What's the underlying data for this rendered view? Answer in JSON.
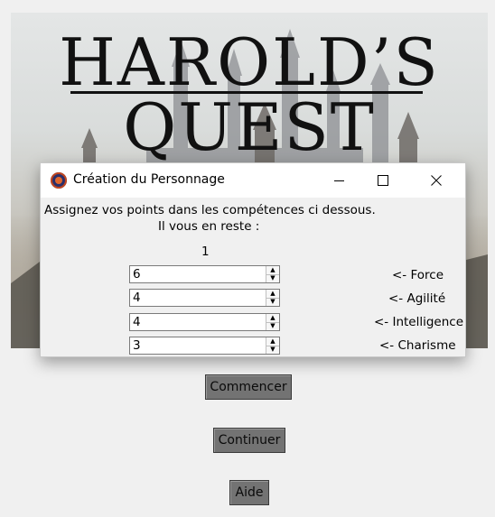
{
  "banner": {
    "title_line1": "HAROLD’S",
    "title_line2": "QUEST"
  },
  "main_buttons": {
    "start": "Commencer",
    "continue": "Continuer",
    "help": "Aide"
  },
  "dialog": {
    "title": "Création du Personnage",
    "instruction_line1": "Assignez vos points dans les compétences ci dessous.",
    "instruction_line2": "Il vous en reste :",
    "remaining_points": "1",
    "skills": [
      {
        "value": "6",
        "label": "<- Force"
      },
      {
        "value": "4",
        "label": "<- Agilité"
      },
      {
        "value": "4",
        "label": "<- Intelligence"
      },
      {
        "value": "3",
        "label": "<- Charisme"
      }
    ]
  },
  "colors": {
    "button_bg": "#737373",
    "app_icon_primary": "#2a2f6b",
    "app_icon_accent": "#e0662d"
  }
}
